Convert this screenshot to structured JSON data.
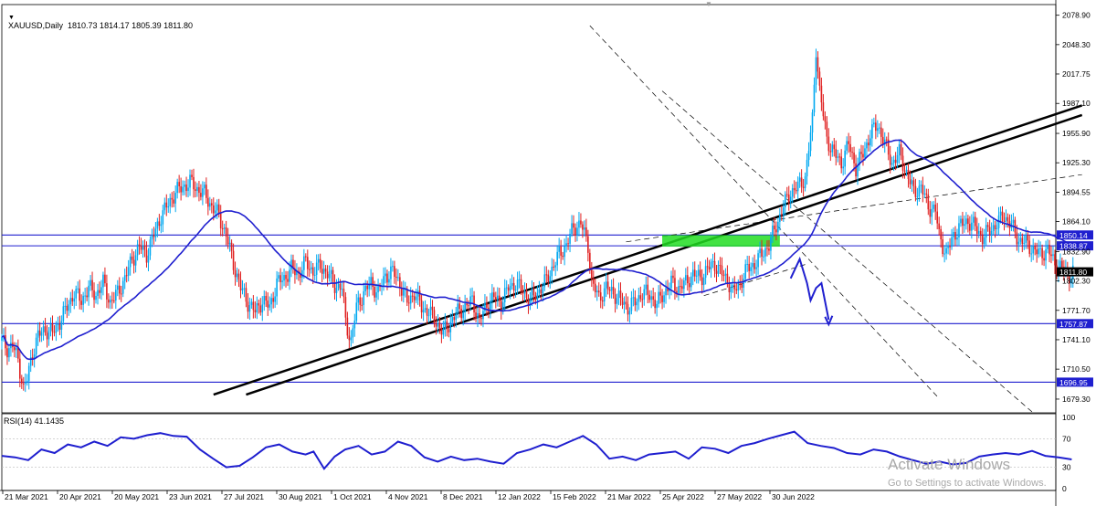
{
  "header": {
    "symbol_line": "XAUUSD,Daily  1810.73 1814.17 1805.39 1811.80"
  },
  "rsi_header": "RSI(14) 41.1435",
  "watermark": {
    "line1": "Activate Windows",
    "line2": "Go to Settings to activate Windows."
  },
  "price_badges": [
    {
      "label": "1850.14",
      "value": 1850.14,
      "color": "#1f1fcf"
    },
    {
      "label": "1838.87",
      "value": 1838.87,
      "color": "#1f1fcf"
    },
    {
      "label": "1811.80",
      "value": 1811.8,
      "color": "#000000"
    },
    {
      "label": "1757.87",
      "value": 1757.87,
      "color": "#1f1fcf"
    },
    {
      "label": "1696.95",
      "value": 1696.95,
      "color": "#1f1fcf"
    }
  ],
  "colors": {
    "bull": "#00a8f0",
    "bear": "#e02020",
    "ma": "#1f1fcf",
    "rsi": "#1f1fcf",
    "trend": "#000000",
    "zone": "#22dd22"
  },
  "chart_data": {
    "type": "candlestick",
    "symbol": "XAUUSD",
    "timeframe": "Daily",
    "ohlc_last": {
      "open": 1810.73,
      "high": 1814.17,
      "low": 1805.39,
      "close": 1811.8
    },
    "x_tick_labels": [
      "21 Mar 2021",
      "20 Apr 2021",
      "20 May 2021",
      "23 Jun 2021",
      "27 Jul 2021",
      "30 Aug 2021",
      "1 Oct 2021",
      "4 Nov 2021",
      "8 Dec 2021",
      "12 Jan 2022",
      "15 Feb 2022",
      "21 Mar 2022",
      "25 Apr 2022",
      "27 May 2022",
      "30 Jun 2022"
    ],
    "y_tick_labels": [
      "2078.90",
      "2048.30",
      "2017.75",
      "1987.10",
      "1955.90",
      "1925.30",
      "1894.55",
      "1864.10",
      "1832.90",
      "1802.30",
      "1771.70",
      "1741.10",
      "1710.50",
      "1679.30"
    ],
    "y_ticks": [
      2078.9,
      2048.3,
      2017.75,
      1987.1,
      1955.9,
      1925.3,
      1894.55,
      1864.1,
      1832.9,
      1802.3,
      1771.7,
      1741.1,
      1710.5,
      1679.3
    ],
    "ylim": [
      1665,
      2090
    ],
    "horizontal_levels": [
      1850.14,
      1838.87,
      1757.87,
      1696.95
    ],
    "close_path": [
      [
        0,
        1740
      ],
      [
        3,
        1732
      ],
      [
        6,
        1735
      ],
      [
        9,
        1720
      ],
      [
        12,
        1690
      ],
      [
        14,
        1700
      ],
      [
        17,
        1728
      ],
      [
        20,
        1745
      ],
      [
        24,
        1752
      ],
      [
        28,
        1748
      ],
      [
        32,
        1760
      ],
      [
        36,
        1775
      ],
      [
        40,
        1790
      ],
      [
        44,
        1782
      ],
      [
        48,
        1795
      ],
      [
        52,
        1788
      ],
      [
        56,
        1800
      ],
      [
        60,
        1780
      ],
      [
        64,
        1790
      ],
      [
        68,
        1805
      ],
      [
        72,
        1825
      ],
      [
        76,
        1838
      ],
      [
        80,
        1830
      ],
      [
        84,
        1850
      ],
      [
        88,
        1870
      ],
      [
        92,
        1882
      ],
      [
        96,
        1895
      ],
      [
        100,
        1900
      ],
      [
        104,
        1905
      ],
      [
        108,
        1898
      ],
      [
        112,
        1893
      ],
      [
        116,
        1880
      ],
      [
        120,
        1870
      ],
      [
        124,
        1850
      ],
      [
        128,
        1820
      ],
      [
        132,
        1795
      ],
      [
        136,
        1780
      ],
      [
        140,
        1770
      ],
      [
        144,
        1782
      ],
      [
        148,
        1775
      ],
      [
        152,
        1800
      ],
      [
        156,
        1805
      ],
      [
        160,
        1815
      ],
      [
        164,
        1810
      ],
      [
        168,
        1822
      ],
      [
        172,
        1812
      ],
      [
        176,
        1818
      ],
      [
        180,
        1810
      ],
      [
        184,
        1798
      ],
      [
        188,
        1795
      ],
      [
        190,
        1760
      ],
      [
        193,
        1740
      ],
      [
        196,
        1775
      ],
      [
        200,
        1790
      ],
      [
        204,
        1800
      ],
      [
        208,
        1790
      ],
      [
        212,
        1808
      ],
      [
        216,
        1812
      ],
      [
        220,
        1800
      ],
      [
        224,
        1780
      ],
      [
        228,
        1790
      ],
      [
        232,
        1775
      ],
      [
        236,
        1770
      ],
      [
        240,
        1760
      ],
      [
        244,
        1748
      ],
      [
        248,
        1760
      ],
      [
        252,
        1770
      ],
      [
        256,
        1775
      ],
      [
        260,
        1782
      ],
      [
        264,
        1760
      ],
      [
        268,
        1778
      ],
      [
        272,
        1785
      ],
      [
        276,
        1780
      ],
      [
        280,
        1795
      ],
      [
        284,
        1800
      ],
      [
        288,
        1792
      ],
      [
        292,
        1782
      ],
      [
        296,
        1790
      ],
      [
        300,
        1800
      ],
      [
        304,
        1815
      ],
      [
        308,
        1830
      ],
      [
        312,
        1840
      ],
      [
        316,
        1858
      ],
      [
        320,
        1862
      ],
      [
        324,
        1840
      ],
      [
        326,
        1800
      ],
      [
        330,
        1785
      ],
      [
        334,
        1795
      ],
      [
        338,
        1790
      ],
      [
        342,
        1782
      ],
      [
        346,
        1775
      ],
      [
        350,
        1780
      ],
      [
        354,
        1790
      ],
      [
        358,
        1788
      ],
      [
        362,
        1778
      ],
      [
        366,
        1790
      ],
      [
        370,
        1800
      ],
      [
        374,
        1795
      ],
      [
        378,
        1800
      ],
      [
        382,
        1810
      ],
      [
        386,
        1805
      ],
      [
        390,
        1815
      ],
      [
        394,
        1820
      ],
      [
        398,
        1810
      ],
      [
        402,
        1800
      ],
      [
        404,
        1790
      ],
      [
        408,
        1800
      ],
      [
        412,
        1815
      ],
      [
        416,
        1820
      ],
      [
        420,
        1830
      ],
      [
        424,
        1840
      ],
      [
        428,
        1860
      ],
      [
        432,
        1880
      ],
      [
        436,
        1895
      ],
      [
        440,
        1900
      ],
      [
        444,
        1910
      ],
      [
        446,
        1940
      ],
      [
        448,
        1970
      ],
      [
        450,
        2045
      ],
      [
        452,
        2000
      ],
      [
        454,
        1975
      ],
      [
        456,
        1950
      ],
      [
        460,
        1935
      ],
      [
        464,
        1925
      ],
      [
        468,
        1945
      ],
      [
        472,
        1920
      ],
      [
        476,
        1935
      ],
      [
        480,
        1955
      ],
      [
        484,
        1965
      ],
      [
        488,
        1945
      ],
      [
        492,
        1925
      ],
      [
        496,
        1935
      ],
      [
        500,
        1915
      ],
      [
        504,
        1895
      ],
      [
        508,
        1900
      ],
      [
        512,
        1880
      ],
      [
        516,
        1875
      ],
      [
        518,
        1850
      ],
      [
        522,
        1830
      ],
      [
        526,
        1850
      ],
      [
        530,
        1860
      ],
      [
        534,
        1865
      ],
      [
        538,
        1858
      ],
      [
        542,
        1848
      ],
      [
        546,
        1855
      ],
      [
        550,
        1862
      ],
      [
        554,
        1870
      ],
      [
        558,
        1860
      ],
      [
        562,
        1845
      ],
      [
        566,
        1842
      ],
      [
        570,
        1835
      ],
      [
        574,
        1830
      ],
      [
        578,
        1835
      ],
      [
        582,
        1820
      ],
      [
        586,
        1815
      ],
      [
        590,
        1808
      ],
      [
        592,
        1811.8
      ]
    ],
    "series": [
      {
        "name": "RSI(14)",
        "last": 41.1435,
        "ylim": [
          0,
          100
        ],
        "levels": [
          30,
          70
        ]
      }
    ],
    "rsi_y_tick_labels": [
      "100",
      "70",
      "30",
      "0"
    ],
    "rsi_values": [
      [
        0,
        46
      ],
      [
        5,
        44
      ],
      [
        10,
        40
      ],
      [
        15,
        55
      ],
      [
        20,
        50
      ],
      [
        25,
        62
      ],
      [
        30,
        58
      ],
      [
        35,
        66
      ],
      [
        40,
        60
      ],
      [
        45,
        72
      ],
      [
        50,
        70
      ],
      [
        55,
        75
      ],
      [
        60,
        78
      ],
      [
        65,
        74
      ],
      [
        70,
        73
      ],
      [
        75,
        55
      ],
      [
        80,
        42
      ],
      [
        85,
        30
      ],
      [
        90,
        32
      ],
      [
        95,
        44
      ],
      [
        100,
        58
      ],
      [
        105,
        62
      ],
      [
        110,
        52
      ],
      [
        115,
        48
      ],
      [
        118,
        52
      ],
      [
        122,
        28
      ],
      [
        126,
        45
      ],
      [
        130,
        55
      ],
      [
        135,
        60
      ],
      [
        140,
        48
      ],
      [
        145,
        52
      ],
      [
        150,
        66
      ],
      [
        155,
        60
      ],
      [
        160,
        44
      ],
      [
        165,
        38
      ],
      [
        170,
        45
      ],
      [
        175,
        40
      ],
      [
        180,
        42
      ],
      [
        185,
        38
      ],
      [
        190,
        35
      ],
      [
        195,
        50
      ],
      [
        200,
        55
      ],
      [
        205,
        62
      ],
      [
        210,
        58
      ],
      [
        215,
        66
      ],
      [
        220,
        74
      ],
      [
        225,
        62
      ],
      [
        230,
        42
      ],
      [
        235,
        45
      ],
      [
        240,
        40
      ],
      [
        245,
        48
      ],
      [
        250,
        50
      ],
      [
        255,
        52
      ],
      [
        260,
        42
      ],
      [
        265,
        58
      ],
      [
        270,
        56
      ],
      [
        275,
        50
      ],
      [
        280,
        60
      ],
      [
        285,
        64
      ],
      [
        290,
        70
      ],
      [
        295,
        75
      ],
      [
        300,
        80
      ],
      [
        305,
        64
      ],
      [
        310,
        60
      ],
      [
        315,
        57
      ],
      [
        320,
        50
      ],
      [
        325,
        48
      ],
      [
        330,
        55
      ],
      [
        335,
        52
      ],
      [
        340,
        45
      ],
      [
        345,
        40
      ],
      [
        350,
        35
      ],
      [
        355,
        38
      ],
      [
        360,
        34
      ],
      [
        365,
        36
      ],
      [
        370,
        45
      ],
      [
        375,
        48
      ],
      [
        380,
        50
      ],
      [
        385,
        48
      ],
      [
        390,
        53
      ],
      [
        395,
        46
      ],
      [
        400,
        44
      ],
      [
        405,
        41
      ]
    ]
  }
}
